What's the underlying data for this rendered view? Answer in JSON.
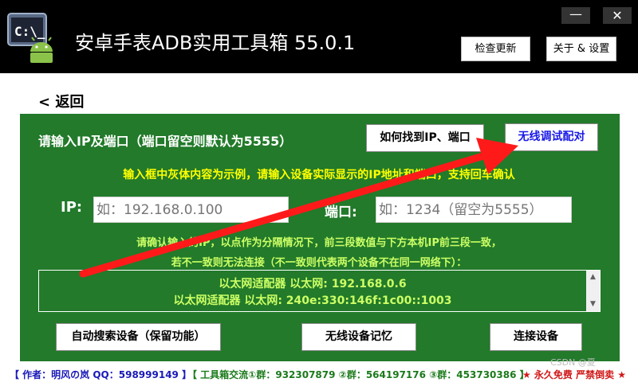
{
  "window": {
    "title": "安卓手表ADB实用工具箱  55.0.1",
    "minimize_glyph": "—",
    "close_glyph": "✕",
    "icon": "android-cmd-icon"
  },
  "toolbar": {
    "update_label": "检查更新",
    "about_label": "关于 & 设置"
  },
  "nav": {
    "back_label": "< 返回"
  },
  "main": {
    "header_label": "请输入IP及端口（端口留空则默认为5555）",
    "find_ip_label": "如何找到IP、端口",
    "wireless_pair_label": "无线调试配对",
    "hint_yellow": "输入框中灰体内容为示例，请输入设备实际显示的IP地址和端口，支持回车确认",
    "ip_label": "IP:",
    "ip_placeholder": "如：192.168.0.100",
    "port_label": "端口:",
    "port_placeholder": "如：1234（留空为5555）",
    "hint_green_1": "请确认输入的IP，以点作为分隔情况下，前三段数值与下方本机IP前三段一致，",
    "hint_green_2": "若不一致则无法连接（不一致则代表两个设备不在同一网络下）：",
    "local_ips": [
      "以太网适配器 以太网:  192.168.0.6",
      "以太网适配器 以太网:  240e:330:146f:1c00::1003"
    ],
    "auto_search_label": "自动搜索设备（保留功能）",
    "device_memory_label": "无线设备记忆",
    "connect_label": "连接设备"
  },
  "footer": {
    "author": "【 作者：明风の岚  QQ：598999149 】",
    "groups": "【 工具箱交流①群：932307879  ②群：564197176  ③群：453730386 】",
    "free_notice": "★ 永久免费 严禁倒卖 ★"
  },
  "watermark": "CSDN @夏",
  "colors": {
    "titlebar": "#000000",
    "panel": "#227a2a",
    "hint_yellow": "#ffff00",
    "hint_green": "#ccff66",
    "link_blue": "#1a1ae6",
    "arrow_red": "#ff1a1a"
  }
}
